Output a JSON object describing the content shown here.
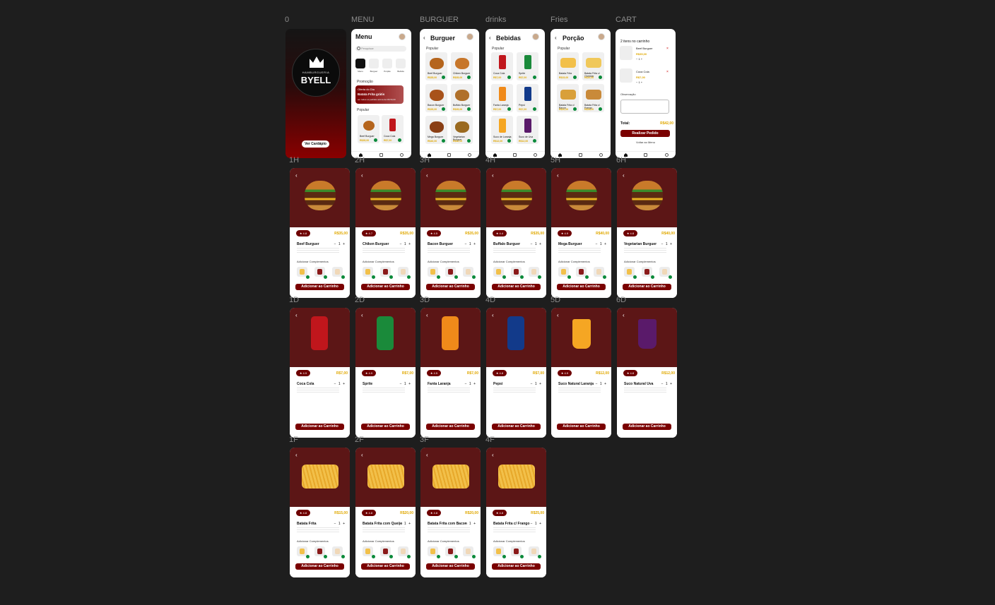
{
  "frame_labels": {
    "splash": "0",
    "menu": "MENU",
    "burguer": "BURGUER",
    "drinks": "drinks",
    "fries": "Fries",
    "cart": "CART",
    "h": [
      "1H",
      "2H",
      "3H",
      "4H",
      "5H",
      "6H"
    ],
    "d": [
      "1D",
      "2D",
      "3D",
      "4D",
      "5D",
      "6D"
    ],
    "f": [
      "1F",
      "2F",
      "3F",
      "4F"
    ]
  },
  "splash": {
    "brand_sub": "HAMBURGUERIA",
    "brand": "BYELL",
    "cta": "Ver Cardápio"
  },
  "menu": {
    "title": "Menu",
    "search_placeholder": "Pesquisar",
    "categories": [
      "Menu",
      "Burguer",
      "Porção",
      "Bebida"
    ],
    "promo_section": "Promoção",
    "promo_line1": "Oferta do Dia",
    "promo_line2": "Batata Frita grátis",
    "promo_line3": "em todos os pedidos acima de R$ 50,00",
    "popular_section": "Popular",
    "popular": [
      {
        "name": "Beef Burguer",
        "price": "R$35,00"
      },
      {
        "name": "Coca Cola",
        "price": "R$7,00"
      }
    ]
  },
  "burguer": {
    "title": "Burguer",
    "section": "Popular",
    "items": [
      {
        "name": "Beef Burguer",
        "price": "R$35,00"
      },
      {
        "name": "Chiken Burguer",
        "price": "R$35,00"
      },
      {
        "name": "Bacon Burguer",
        "price": "R$35,00"
      },
      {
        "name": "Buffalo Burguer",
        "price": "R$35,00"
      },
      {
        "name": "Mega Burguer",
        "price": "R$40,00"
      },
      {
        "name": "Vegetarian Burguer",
        "price": "R$40,00"
      }
    ]
  },
  "drinks": {
    "title": "Bebidas",
    "section": "Popular",
    "items": [
      {
        "name": "Coca Cola",
        "price": "R$7,00"
      },
      {
        "name": "Sprite",
        "price": "R$7,00"
      },
      {
        "name": "Fanta Laranja",
        "price": "R$7,00"
      },
      {
        "name": "Pepsi",
        "price": "R$7,00"
      },
      {
        "name": "Suco de Laranja",
        "price": "R$12,00"
      },
      {
        "name": "Suco de Uva",
        "price": "R$12,00"
      }
    ]
  },
  "fries": {
    "title": "Porção",
    "section": "Popular",
    "items": [
      {
        "name": "Batata Frita",
        "price": "R$15,00"
      },
      {
        "name": "Batata Frita c/ Cheddar",
        "price": "R$20,00"
      },
      {
        "name": "Batata Frita c/ Bacon",
        "price": "R$20,00"
      },
      {
        "name": "Batata Frita c/ Frango",
        "price": "R$25,00"
      }
    ]
  },
  "cart": {
    "title": "2 itens no carrinho",
    "items": [
      {
        "name": "Beef Burguer",
        "price": "R$35,00"
      },
      {
        "name": "Coca Cola",
        "price": "R$7,00"
      }
    ],
    "observation_label": "Observação",
    "total_label": "Total:",
    "total_value": "R$42,00",
    "checkout": "Realizar Pedido",
    "back": "Voltar ao Menu"
  },
  "detail_common": {
    "complement_label": "Adicionar Complementos",
    "add_button": "Adicionar ao Carrinho",
    "qty": "− 1 +"
  },
  "burger_details": [
    {
      "rating": "★ 4.8",
      "price": "R$35,00",
      "name": "Beef Burguer"
    },
    {
      "rating": "★ 4.7",
      "price": "R$35,00",
      "name": "Chiken Burguer"
    },
    {
      "rating": "★ 4.5",
      "price": "R$35,00",
      "name": "Bacon Burguer"
    },
    {
      "rating": "★ 4.4",
      "price": "R$35,00",
      "name": "Buffalo Burguer"
    },
    {
      "rating": "★ 4.9",
      "price": "R$40,00",
      "name": "Mega Burguer"
    },
    {
      "rating": "★ 4.8",
      "price": "R$40,00",
      "name": "Vegetarian Burguer"
    }
  ],
  "drink_details": [
    {
      "rating": "★ 4.9",
      "price": "R$7,00",
      "name": "Coca Cola"
    },
    {
      "rating": "★ 4.9",
      "price": "R$7,00",
      "name": "Sprite"
    },
    {
      "rating": "★ 4.5",
      "price": "R$7,00",
      "name": "Fanta Laranja"
    },
    {
      "rating": "★ 4.8",
      "price": "R$7,00",
      "name": "Pepsi"
    },
    {
      "rating": "★ 4.9",
      "price": "R$12,00",
      "name": "Suco Natural Laranja"
    },
    {
      "rating": "★ 4.8",
      "price": "R$12,00",
      "name": "Suco Natural Uva"
    }
  ],
  "fries_details": [
    {
      "rating": "★ 4.8",
      "price": "R$15,00",
      "name": "Batata Frita"
    },
    {
      "rating": "★ 4.8",
      "price": "R$20,00",
      "name": "Batata Frita com Queijo"
    },
    {
      "rating": "★ 4.8",
      "price": "R$20,00",
      "name": "Batata Frita com Bacon"
    },
    {
      "rating": "★ 4.8",
      "price": "R$25,00",
      "name": "Batata Frita c/ Frango"
    }
  ],
  "colors": {
    "brand_red": "#7a0000",
    "price_yellow": "#e0a800",
    "add_green": "#0a8a3a"
  },
  "icons": [
    "back-arrow-icon",
    "search-icon",
    "home-icon",
    "cart-icon",
    "user-icon",
    "plus-icon",
    "remove-icon",
    "star-icon"
  ]
}
